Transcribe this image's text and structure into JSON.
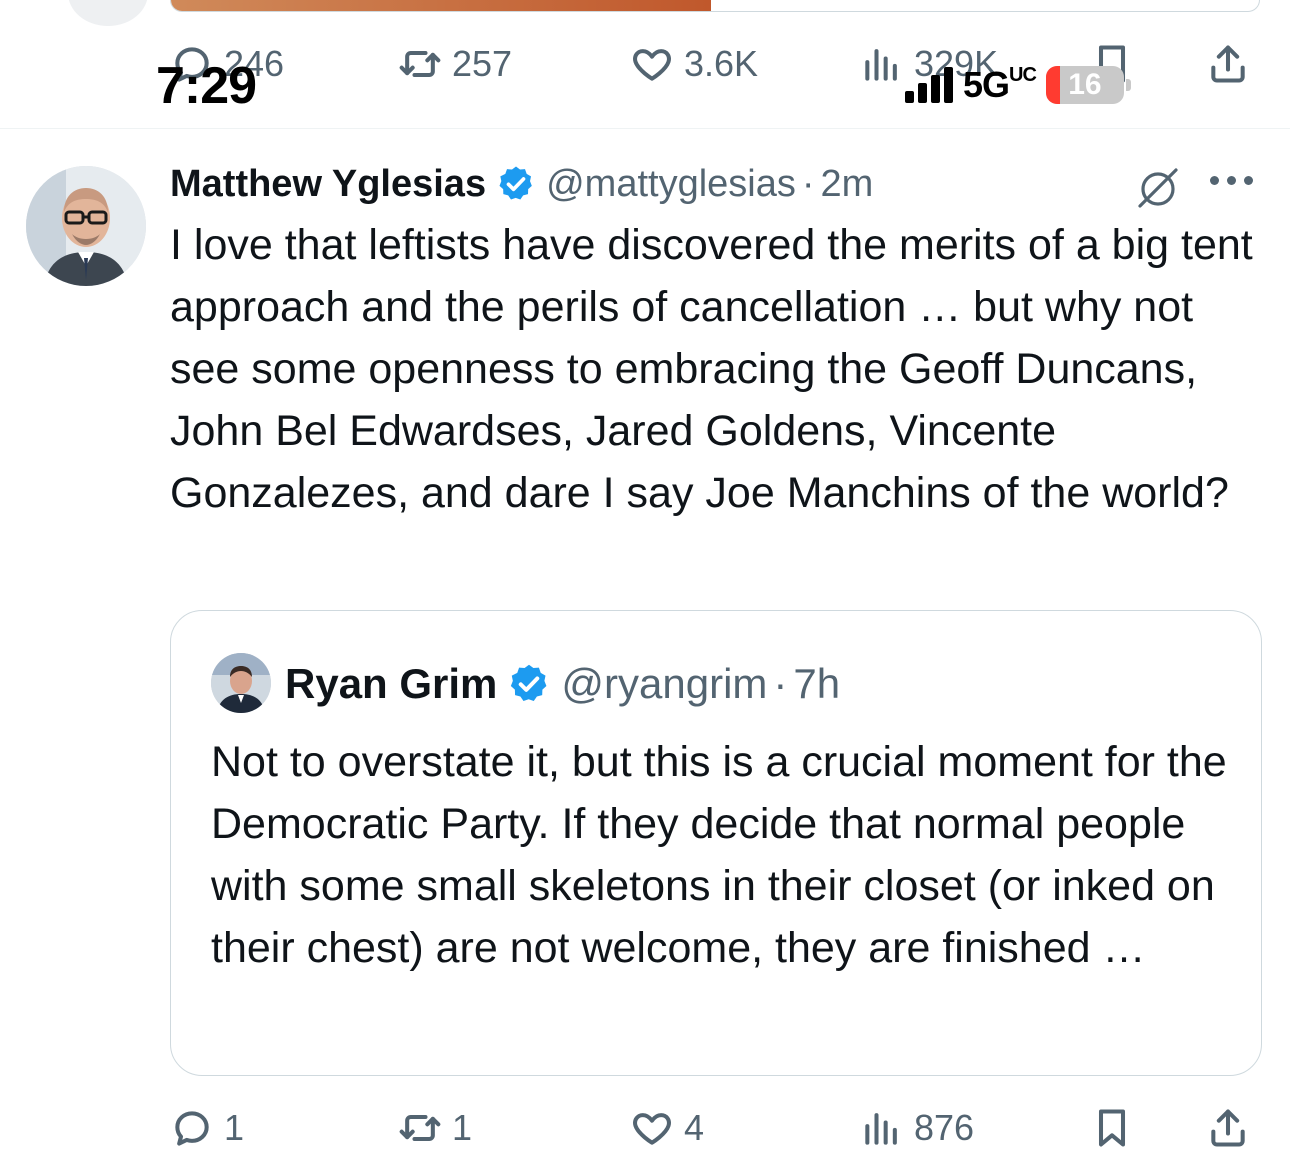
{
  "status_bar": {
    "time": "7:29",
    "network": "5G",
    "network_suffix": "UC",
    "battery": "16"
  },
  "previous_tweet": {
    "actions": {
      "replies": "246",
      "retweets": "257",
      "likes": "3.6K",
      "views": "329K"
    }
  },
  "tweet": {
    "author_name": "Matthew Yglesias",
    "handle": "@mattyglesias",
    "separator": "·",
    "time": "2m",
    "text": "I love that leftists have discovered the merits of a big tent approach and the perils of cancellation … but why not see some openness to embracing the Geoff Duncans, John Bel Edwardses, Jared Goldens, Vincente Gonzalezes, and dare I say Joe Manchins of the world?",
    "quote": {
      "author_name": "Ryan Grim",
      "handle": "@ryangrim",
      "separator": "·",
      "time": "7h",
      "text": "Not to overstate it, but this is a crucial moment for the Democratic Party. If they decide that normal people with some small skeletons in their closet (or inked on their chest) are not welcome, they are finished …"
    },
    "actions": {
      "replies": "1",
      "retweets": "1",
      "likes": "4",
      "views": "876"
    }
  },
  "colors": {
    "text_primary": "#0f1419",
    "text_secondary": "#536471",
    "verified_blue": "#1d9bf0",
    "border": "#cfd9de",
    "battery_low": "#ff3b30"
  },
  "icons": [
    "reply-icon",
    "retweet-icon",
    "like-icon",
    "views-icon",
    "bookmark-icon",
    "share-icon",
    "verified-badge-icon",
    "grok-icon",
    "more-icon"
  ]
}
